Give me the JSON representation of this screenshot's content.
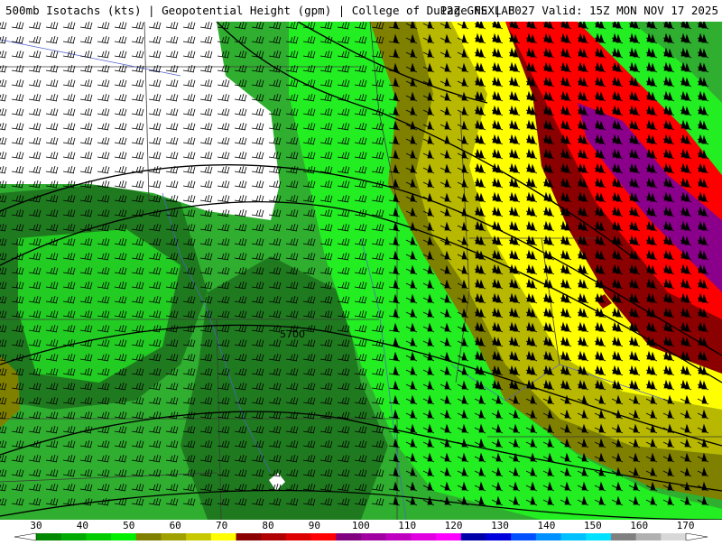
{
  "header": {
    "left_title": "500mb Isotachs (kts) | Geopotential Height (gpm) | College of DuPage NEXLAB",
    "right_title": "12Z GFS | F027 Valid: 15Z MON NOV 17 2025"
  },
  "contour_label": "5700",
  "colorbar": {
    "ticks": [
      "30",
      "40",
      "50",
      "60",
      "70",
      "80",
      "90",
      "100",
      "110",
      "120",
      "130",
      "140",
      "150",
      "160",
      "170"
    ],
    "colors": [
      "#008800",
      "#00aa00",
      "#00cc00",
      "#00ee00",
      "#808000",
      "#a0a000",
      "#c8c800",
      "#ffff00",
      "#8b0000",
      "#b00000",
      "#dd0000",
      "#ff0000",
      "#800080",
      "#a000a0",
      "#c000c0",
      "#e000e0",
      "#ff00ff",
      "#0000aa",
      "#0000dd",
      "#0050ff",
      "#0090ff",
      "#00c0ff",
      "#00e0ff",
      "#808080",
      "#b0b0b0",
      "#d8d8d8"
    ]
  },
  "colors": {
    "calm": "#ffffff",
    "dark_green": "#1f7a1f",
    "mid_green": "#2fae2f",
    "green": "#22cc22",
    "bright_green": "#22ee22",
    "olive": "#808000",
    "mustard": "#b8b800",
    "yellow": "#ffff00",
    "dark_red": "#8b0000",
    "red": "#ff0000",
    "purple": "#8a008a"
  }
}
